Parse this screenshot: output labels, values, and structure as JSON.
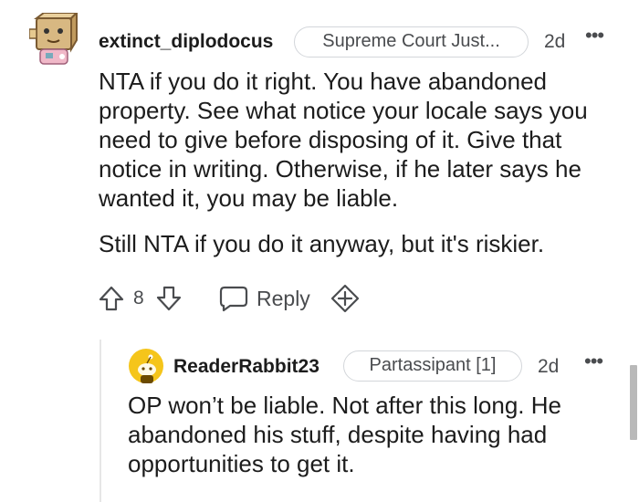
{
  "comment": {
    "username": "extinct_diplodocus",
    "flair": "Supreme Court Just...",
    "time": "2d",
    "more": "•••",
    "paragraphs": [
      "NTA if you do it right. You have abandoned property. See what notice your locale says you need to give before disposing of it. Give that notice in writing. Otherwise, if he later says he wanted it, you may be liable.",
      "Still NTA if you do it anyway, but it's riskier."
    ],
    "actions": {
      "vote_count": "8",
      "reply_label": "Reply"
    },
    "icons": {
      "avatar": "diplodocus-avatar-icon",
      "upvote": "upvote-arrow-icon",
      "downvote": "downvote-arrow-icon",
      "reply": "speech-bubble-icon",
      "award": "add-award-icon"
    }
  },
  "reply": {
    "username": "ReaderRabbit23",
    "flair": "Partassipant [1]",
    "time": "2d",
    "more": "•••",
    "text": "OP won’t be liable. Not after this long. He abandoned his stuff, despite having had opportunities to get it.",
    "icons": {
      "avatar": "snoo-avatar-icon"
    }
  },
  "colors": {
    "text": "#1c1c1c",
    "meta": "#4a4c4f",
    "border": "#d3d6da",
    "avatar_yellow": "#f5c51b"
  }
}
